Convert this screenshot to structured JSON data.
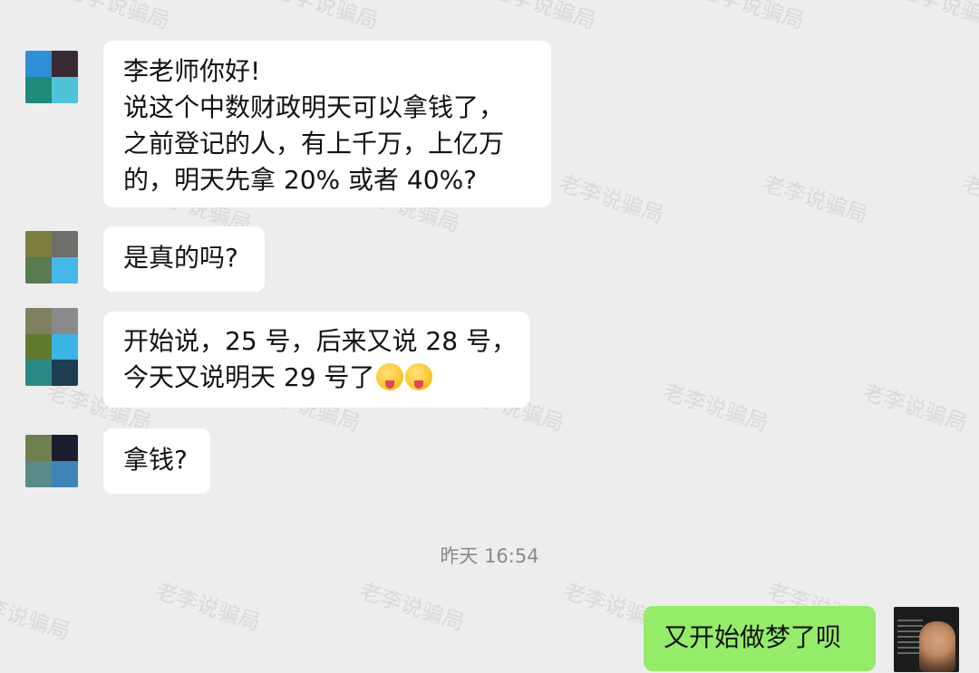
{
  "watermark": "老李说骗局",
  "messages": [
    {
      "lines": [
        "李老师你好!",
        "说这个中数财政明天可以拿钱了，",
        "之前登记的人，有上千万，上亿万",
        "的，明天先拿 20% 或者 40%?"
      ]
    },
    {
      "lines": [
        "是真的吗?"
      ]
    },
    {
      "lines": [
        "开始说，25 号，后来又说 28 号，",
        "今天又说明天 29 号了"
      ],
      "emojis": [
        "winking-tongue-emoji",
        "winking-tongue-emoji"
      ]
    },
    {
      "lines": [
        "拿钱?"
      ]
    }
  ],
  "timestamp": "昨天 16:54",
  "self_message": "又开始做梦了呗",
  "colors": {
    "background": "#ededed",
    "incoming_bubble": "#ffffff",
    "outgoing_bubble": "#95ec69"
  },
  "avatar_tiles": [
    [
      "#2f8fd6",
      "#3a2a33",
      "#1f8a7a",
      "#4fc3d9"
    ],
    [
      "#7e7f3e",
      "#6f6e6a",
      "#5a7a52",
      "#45b7e8"
    ],
    [
      "#7f8060",
      "#8a8a8a",
      "#5f7a2c",
      "#3ab5e6",
      "#2a8a86",
      "#1d3e52"
    ],
    [
      "#6f8050",
      "#1d1d30",
      "#5a8a88",
      "#3f84b6"
    ]
  ]
}
